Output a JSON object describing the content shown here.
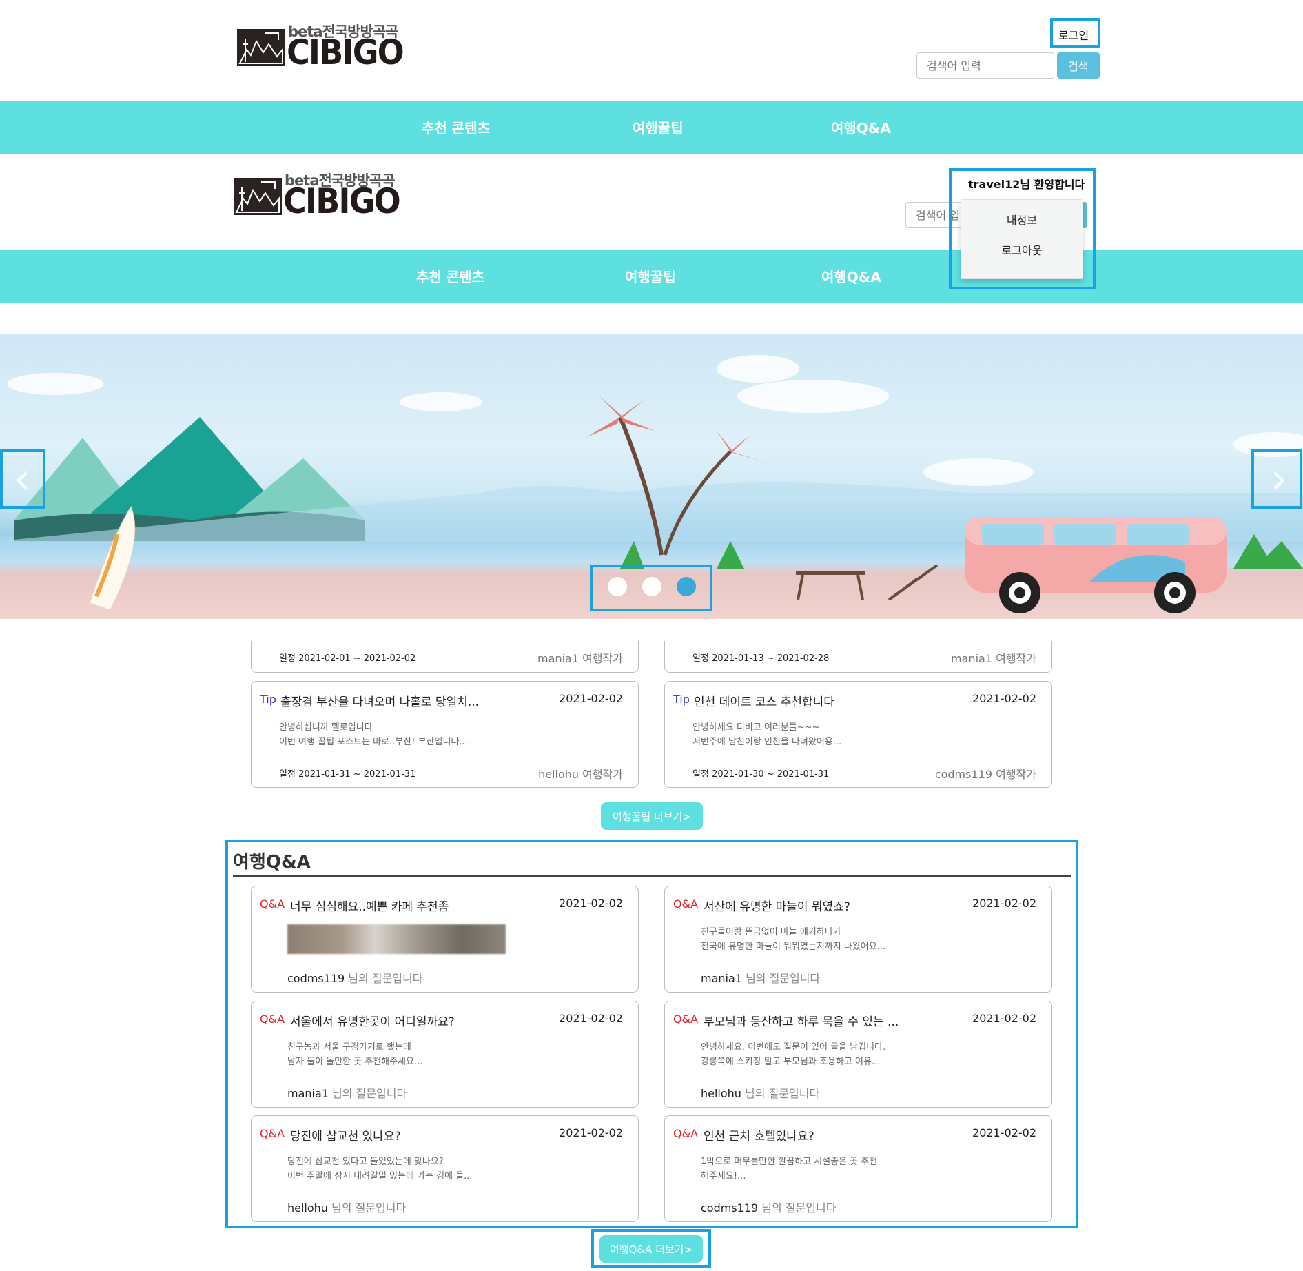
{
  "header_a": {
    "logo": {
      "beta_text": "beta전국방방곡곡",
      "word": "CIBIGO"
    },
    "login_label": "로그인",
    "search": {
      "placeholder": "검색어 입력",
      "button_label": "검색"
    },
    "nav": [
      "추천 콘텐츠",
      "여행꿀팁",
      "여행Q&A"
    ]
  },
  "header_b": {
    "logo": {
      "beta_text": "beta전국방방곡곡",
      "word": "CIBIGO"
    },
    "welcome": "travel12님 환영합니다",
    "search": {
      "placeholder": "검색어 입력"
    },
    "dropdown": [
      "내정보",
      "로그아웃"
    ],
    "nav": [
      "추천 콘텐츠",
      "여행꿀팁",
      "여행Q&A"
    ]
  },
  "carousel": {
    "prev_icon": "chevron-left-icon",
    "next_icon": "chevron-right-icon",
    "slide_count": 3,
    "active_index": 2
  },
  "tips": {
    "partial_row": [
      {
        "schedule_label": "일정",
        "schedule": "2021-02-01 ~ 2021-02-02",
        "author": "mania1",
        "author_suffix": "여행작가"
      },
      {
        "schedule_label": "일정",
        "schedule": "2021-01-13 ~ 2021-02-28",
        "author": "mania1",
        "author_suffix": "여행작가"
      }
    ],
    "cards": [
      {
        "tag": "Tip",
        "title": "출장겸 부산을 다녀오며 나홀로 당일치...",
        "date": "2021-02-02",
        "desc1": "안녕하십니까 헬로입니다",
        "desc2": "이번 여행 꿀팁 포스트는 바로..부산! 부산입니다...",
        "schedule_label": "일정",
        "schedule": "2021-01-31 ~ 2021-01-31",
        "author": "hellohu",
        "author_suffix": "여행작가"
      },
      {
        "tag": "Tip",
        "title": "인천 데이트 코스 추천합니다",
        "date": "2021-02-02",
        "desc1": "안녕하세요 디비고 여러분들~~~",
        "desc2": "저번주에 남친이랑 인천을 다녀왔어용...",
        "schedule_label": "일정",
        "schedule": "2021-01-30 ~ 2021-01-31",
        "author": "codms119",
        "author_suffix": "여행작가"
      }
    ],
    "more_label": "여행꿀팁 더보기>"
  },
  "qa": {
    "section_title": "여행Q&A",
    "cards": [
      {
        "tag": "Q&A",
        "title": "너무 심심해요..예쁜 카페 추천좀",
        "date": "2021-02-02",
        "has_image": true,
        "asker": "codms119",
        "asker_suffix": "님의 질문입니다"
      },
      {
        "tag": "Q&A",
        "title": "서산에 유명한 마늘이 뭐였죠?",
        "date": "2021-02-02",
        "desc1": "친구들이랑 뜬금없이 마늘 얘기하다가",
        "desc2": "전국에 유명한 마늘이 뭐뭐였는지까지 나왔어요...",
        "asker": "mania1",
        "asker_suffix": "님의 질문입니다"
      },
      {
        "tag": "Q&A",
        "title": "서울에서 유명한곳이 어디일까요?",
        "date": "2021-02-02",
        "desc1": "친구놈과 서울 구경가기로 했는데",
        "desc2": "남자 둘이 놀만한 곳 추천해주세요...",
        "asker": "mania1",
        "asker_suffix": "님의 질문입니다"
      },
      {
        "tag": "Q&A",
        "title": "부모님과 등산하고 하루 묵을 수 있는 ...",
        "date": "2021-02-02",
        "desc1": "안녕하세요. 이번에도 질문이 있어 글을 남깁니다.",
        "desc2": "강릉쪽에 스키장 말고 부모님과 조용하고 여유...",
        "asker": "hellohu",
        "asker_suffix": "님의 질문입니다"
      },
      {
        "tag": "Q&A",
        "title": "당진에 삽교천 있나요?",
        "date": "2021-02-02",
        "desc1": "당진에 삽교천 있다고 들었었는데 맞나요?",
        "desc2": "이번 주말에 잠시 내려갈일 있는데 가는 김에 들...",
        "asker": "hellohu",
        "asker_suffix": "님의 질문입니다"
      },
      {
        "tag": "Q&A",
        "title": "인천 근처 호텔있나요?",
        "date": "2021-02-02",
        "desc1": "1박으로 머무를만한 깔끔하고 시설좋은 곳 추천",
        "desc2": "해주세요!...",
        "asker": "codms119",
        "asker_suffix": "님의 질문입니다"
      }
    ],
    "more_label": "여행Q&A 더보기>"
  },
  "colors": {
    "nav_bg": "#5fe0e0",
    "highlight": "#1aa1e0",
    "tip_tag": "#2f35c8",
    "qa_tag": "#e3232a",
    "search_btn": "#5bc0de"
  }
}
